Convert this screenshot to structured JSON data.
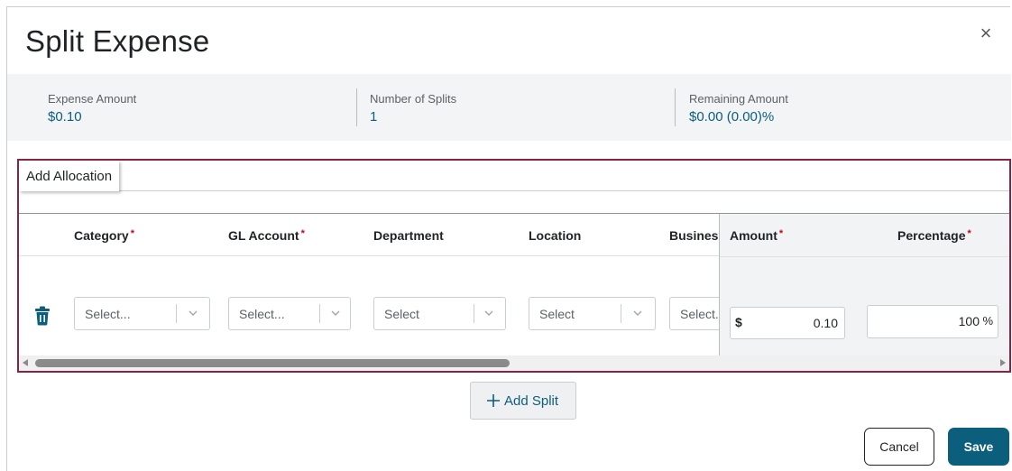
{
  "dialog": {
    "title": "Split Expense",
    "close_icon": "close-icon",
    "close_glyph": "×"
  },
  "summary": {
    "expense_amount": {
      "label": "Expense Amount",
      "value": "$0.10"
    },
    "number_of_splits": {
      "label": "Number of Splits",
      "value": "1"
    },
    "remaining_amount": {
      "label": "Remaining Amount",
      "value": "$0.00 (0.00)%"
    }
  },
  "allocation": {
    "tab_label": "Add Allocation",
    "columns": {
      "category": "Category",
      "gl_account": "GL Account",
      "department": "Department",
      "location": "Location",
      "business": "Business",
      "amount": "Amount",
      "percentage": "Percentage"
    },
    "required_marker": "*",
    "row": {
      "delete_icon": "trash-icon",
      "category_placeholder": "Select...",
      "gl_account_placeholder": "Select...",
      "department_placeholder": "Select",
      "location_placeholder": "Select",
      "business_placeholder": "Select...",
      "currency_symbol": "$",
      "amount_value": "0.10",
      "percentage_value": "100",
      "percent_symbol": "%"
    }
  },
  "actions": {
    "add_split_label": "Add Split",
    "cancel_label": "Cancel",
    "save_label": "Save"
  },
  "colors": {
    "accent": "#0c5e7d",
    "highlight_border": "#8b2244",
    "required": "#d0021b"
  }
}
